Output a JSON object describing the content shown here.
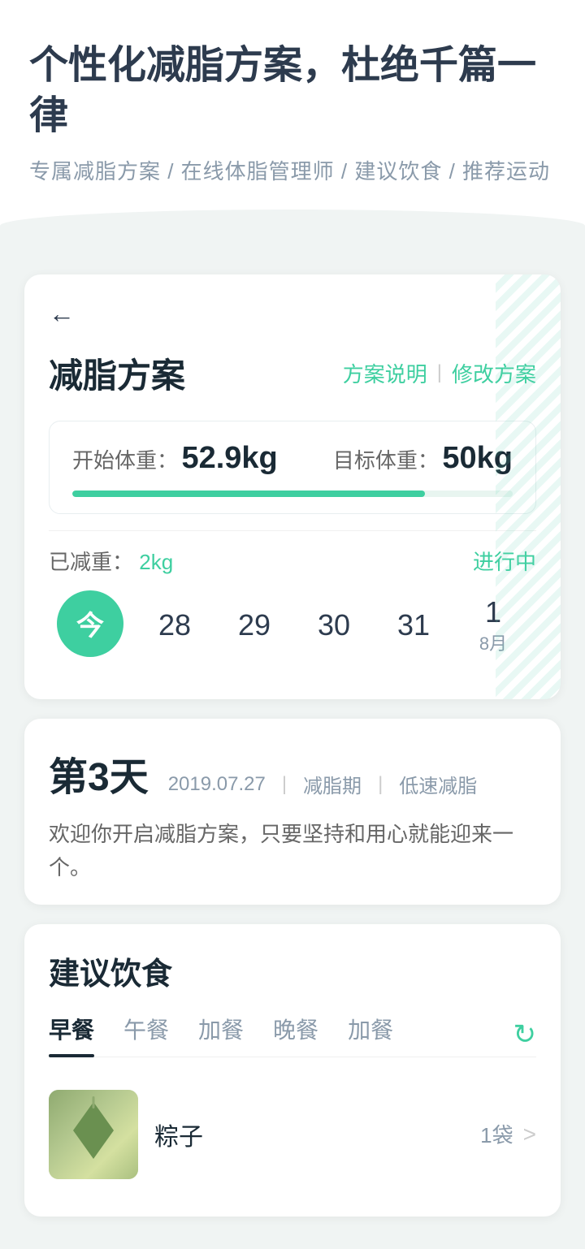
{
  "header": {
    "title": "个性化减脂方案，杜绝千篇一律",
    "subtitle": "专属减脂方案 / 在线体脂管理师 / 建议饮食 / 推荐运动"
  },
  "plan_card": {
    "back_icon": "←",
    "title": "减脂方案",
    "action_explain": "方案说明",
    "action_divider": "|",
    "action_modify": "修改方案",
    "start_weight_label": "开始体重：",
    "start_weight_value": "52.9kg",
    "target_weight_label": "目标体重：",
    "target_weight_value": "50kg",
    "progress_percent": 80,
    "lost_label": "已减重：",
    "lost_value": "2kg",
    "status": "进行中"
  },
  "date_strip": {
    "today_label": "今",
    "dates": [
      {
        "num": "28",
        "month": null
      },
      {
        "num": "29",
        "month": null
      },
      {
        "num": "30",
        "month": null
      },
      {
        "num": "31",
        "month": null
      },
      {
        "num": "1",
        "month": "8月"
      }
    ]
  },
  "day_info": {
    "day_label": "第3天",
    "date": "2019.07.27",
    "period": "减脂期",
    "phase": "低速减脂",
    "description": "欢迎你开启减脂方案，只要坚持和用心就能迎来一个。"
  },
  "food_section": {
    "title": "建议饮食",
    "tabs": [
      "早餐",
      "午餐",
      "加餐",
      "晚餐",
      "加餐"
    ],
    "active_tab_index": 0,
    "refresh_icon": "↻",
    "items": [
      {
        "name": "粽子",
        "quantity": "1袋",
        "chevron": ">"
      }
    ]
  }
}
